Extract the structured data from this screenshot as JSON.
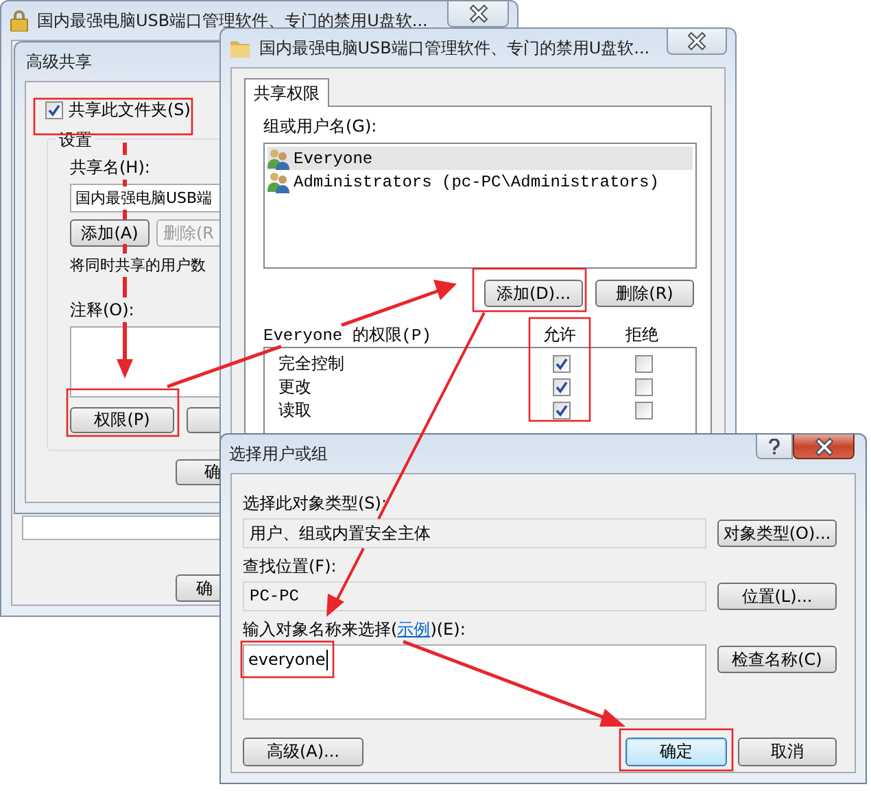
{
  "back_window": {
    "title": "国内最强电脑USB端口管理软件、专门的禁用U盘软...",
    "ok_button": "确"
  },
  "advanced_sharing": {
    "title": "高级共享",
    "share_checkbox": {
      "label": "共享此文件夹(S)",
      "checked": true
    },
    "settings_group": "设置",
    "share_name_label": "共享名(H):",
    "share_name_value": "国内最强电脑USB端",
    "add_button": "添加(A)",
    "remove_button": {
      "label": "删除(R",
      "disabled": true
    },
    "limit_text": "将同时共享的用户数",
    "comment_label": "注释(O):",
    "permissions_button": "权限(P)",
    "ok_button": "确"
  },
  "permissions_window": {
    "title": "国内最强电脑USB端口管理软件、专门的禁用U盘软...",
    "tab": {
      "label": "共享权限",
      "selected": true
    },
    "users_label": "组或用户名(G):",
    "users": [
      {
        "name": "Everyone",
        "selected": true
      },
      {
        "name": "Administrators (pc-PC\\Administrators)",
        "selected": false
      }
    ],
    "add_button": "添加(D)...",
    "remove_button": "删除(R)",
    "permissions_label": "Everyone 的权限(P)",
    "columns": [
      "允许",
      "拒绝"
    ],
    "permissions": [
      {
        "name": "完全控制",
        "allow": true,
        "deny": false
      },
      {
        "name": "更改",
        "allow": true,
        "deny": false
      },
      {
        "name": "读取",
        "allow": true,
        "deny": false
      }
    ]
  },
  "select_dialog": {
    "title": "选择用户或组",
    "object_type_label": "选择此对象类型(S):",
    "object_type_value": "用户、组或内置安全主体",
    "object_types_button": "对象类型(O)...",
    "location_label": "查找位置(F):",
    "location_value": "PC-PC",
    "locations_button": "位置(L)...",
    "name_label": "输入对象名称来选择(",
    "name_label_link": "示例",
    "name_label_end": ")(E):",
    "name_value": "everyone",
    "check_names_button": "检查名称(C)",
    "advanced_button": "高级(A)...",
    "ok_button": "确定",
    "cancel_button": "取消"
  }
}
